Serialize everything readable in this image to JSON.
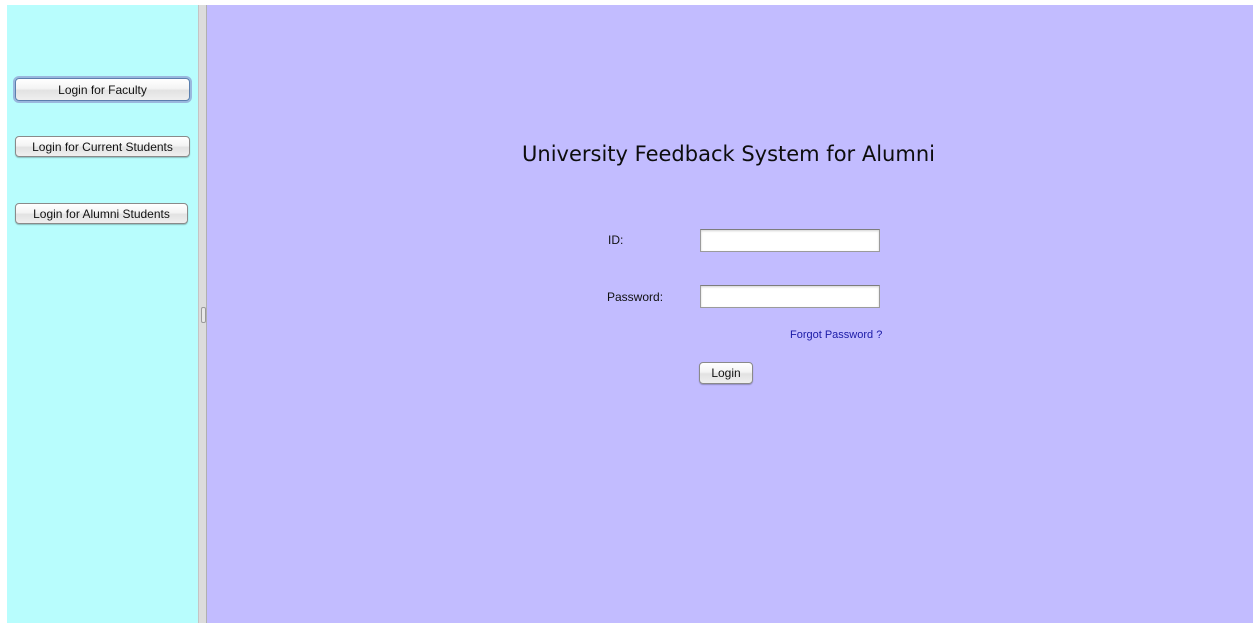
{
  "sidebar": {
    "buttons": [
      {
        "label": "Login for Faculty"
      },
      {
        "label": "Login for Current Students"
      },
      {
        "label": "Login for Alumni Students"
      }
    ]
  },
  "main": {
    "title": "University Feedback System for Alumni",
    "form": {
      "id_label": "ID:",
      "id_value": "",
      "password_label": "Password:",
      "password_value": "",
      "forgot_link": "Forgot Password ?",
      "login_button": "Login"
    }
  },
  "colors": {
    "sidebar_bg": "#b8fdfd",
    "main_bg": "#c2bcff",
    "link": "#1a1aa6"
  }
}
